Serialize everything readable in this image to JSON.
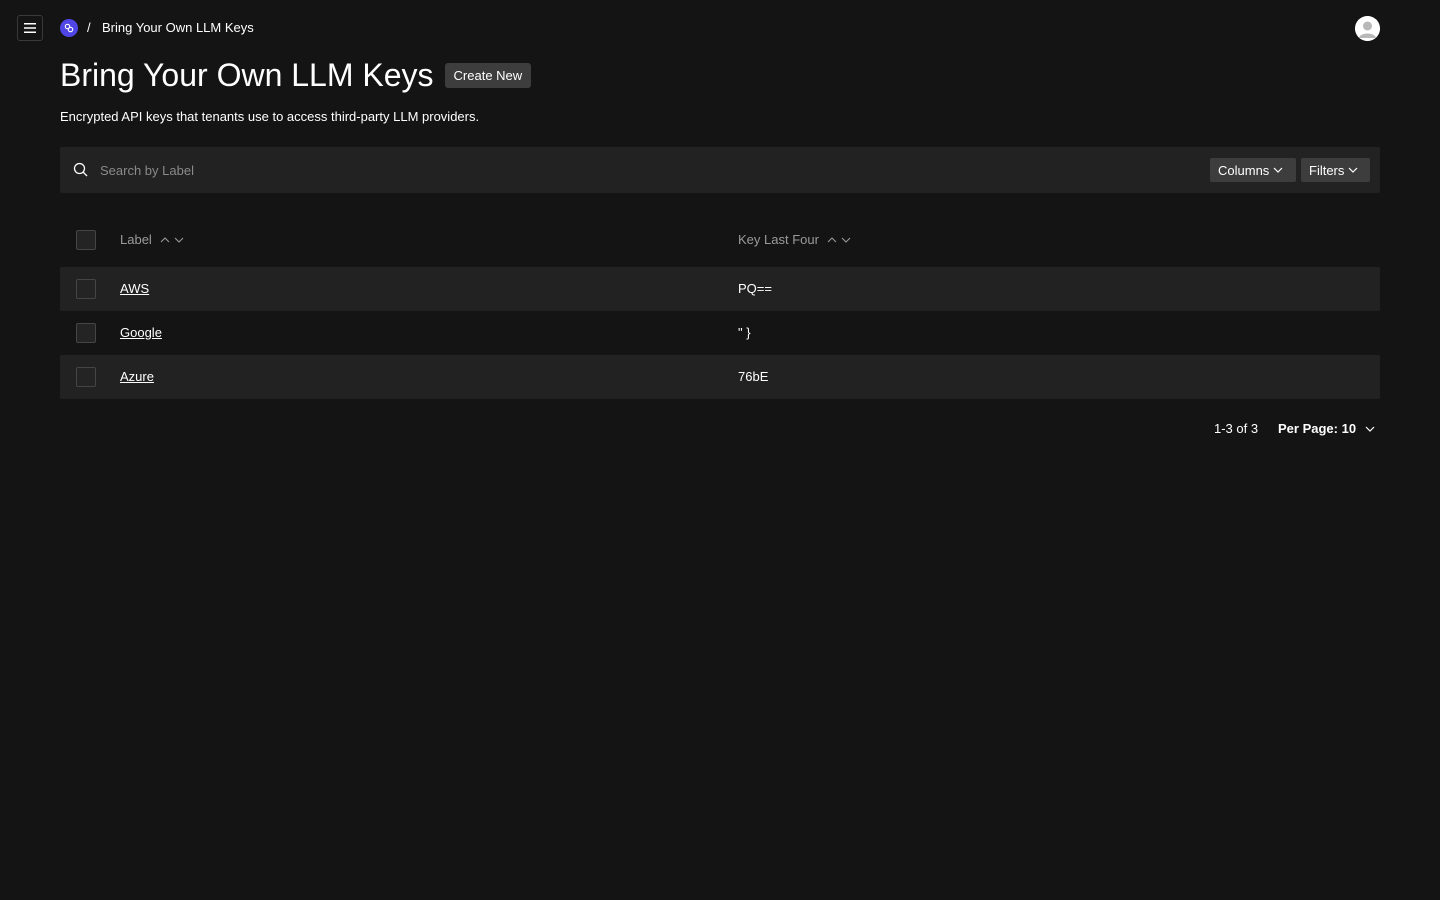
{
  "header": {
    "menu_icon": "hamburger-menu-icon",
    "logo_icon": "app-logo-icon",
    "breadcrumb_separator": "/",
    "breadcrumb_current": "Bring Your Own LLM Keys",
    "avatar_icon": "user-avatar-icon"
  },
  "page": {
    "title": "Bring Your Own LLM Keys",
    "create_label": "Create New",
    "description": "Encrypted API keys that tenants use to access third-party LLM providers."
  },
  "search": {
    "placeholder": "Search by Label",
    "icon": "search-icon"
  },
  "toolbar": {
    "columns_label": "Columns",
    "filters_label": "Filters"
  },
  "table": {
    "columns": [
      "Label",
      "Key Last Four"
    ],
    "rows": [
      {
        "label": "AWS",
        "key_last_four": "PQ=="
      },
      {
        "label": "Google",
        "key_last_four": "\" }"
      },
      {
        "label": "Azure",
        "key_last_four": "76bE"
      }
    ]
  },
  "pagination": {
    "range": "1-3 of 3",
    "per_page": "Per Page: 10"
  },
  "colors": {
    "background": "#141414",
    "panel": "#222222",
    "button": "#3d3d3d",
    "brand": "#4f46e5",
    "muted_text": "#9a9a9a"
  }
}
